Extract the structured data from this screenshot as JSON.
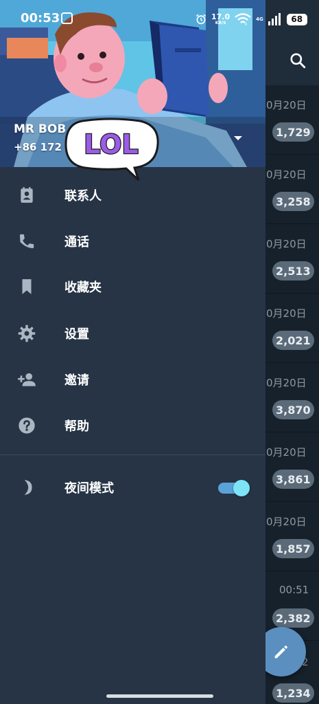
{
  "status_bar": {
    "time": "00:53",
    "net_speed_value": "17.0",
    "net_speed_unit": "KB/S",
    "network_type": "4G",
    "battery": "68",
    "icons": [
      "app-notification-icon",
      "alarm-icon",
      "wifi-icon",
      "signal-icon",
      "battery-icon"
    ]
  },
  "drawer": {
    "profile": {
      "name": "MR BOB",
      "phone": "+86 172",
      "sticker_text": "LOL"
    },
    "menu": [
      {
        "label": "联系人",
        "icon": "contacts-icon"
      },
      {
        "label": "通话",
        "icon": "phone-icon"
      },
      {
        "label": "收藏夹",
        "icon": "bookmark-icon"
      },
      {
        "label": "设置",
        "icon": "gear-icon"
      },
      {
        "label": "邀请",
        "icon": "add-person-icon"
      },
      {
        "label": "帮助",
        "icon": "help-icon"
      }
    ],
    "night_mode": {
      "label": "夜间模式",
      "icon": "moon-icon",
      "enabled": true
    }
  },
  "chat_list": {
    "rows": [
      {
        "date": "0月20日",
        "badge": "1,729"
      },
      {
        "date": "0月20日",
        "badge": "3,258"
      },
      {
        "date": "0月20日",
        "badge": "2,513"
      },
      {
        "date": "0月20日",
        "badge": "2,021"
      },
      {
        "date": "0月20日",
        "badge": "3,870"
      },
      {
        "date": "0月20日",
        "badge": "3,861"
      },
      {
        "date": "0月20日",
        "badge": "1,857"
      },
      {
        "date": "00:51",
        "badge": "2,382"
      },
      {
        "date": "2",
        "badge": "1,234"
      }
    ]
  },
  "colors": {
    "drawer_bg": "#263445",
    "chat_bg": "#17212b",
    "badge_bg": "#5b6a78",
    "accent": "#5a8fc0",
    "switch_thumb": "#7de4f7"
  }
}
